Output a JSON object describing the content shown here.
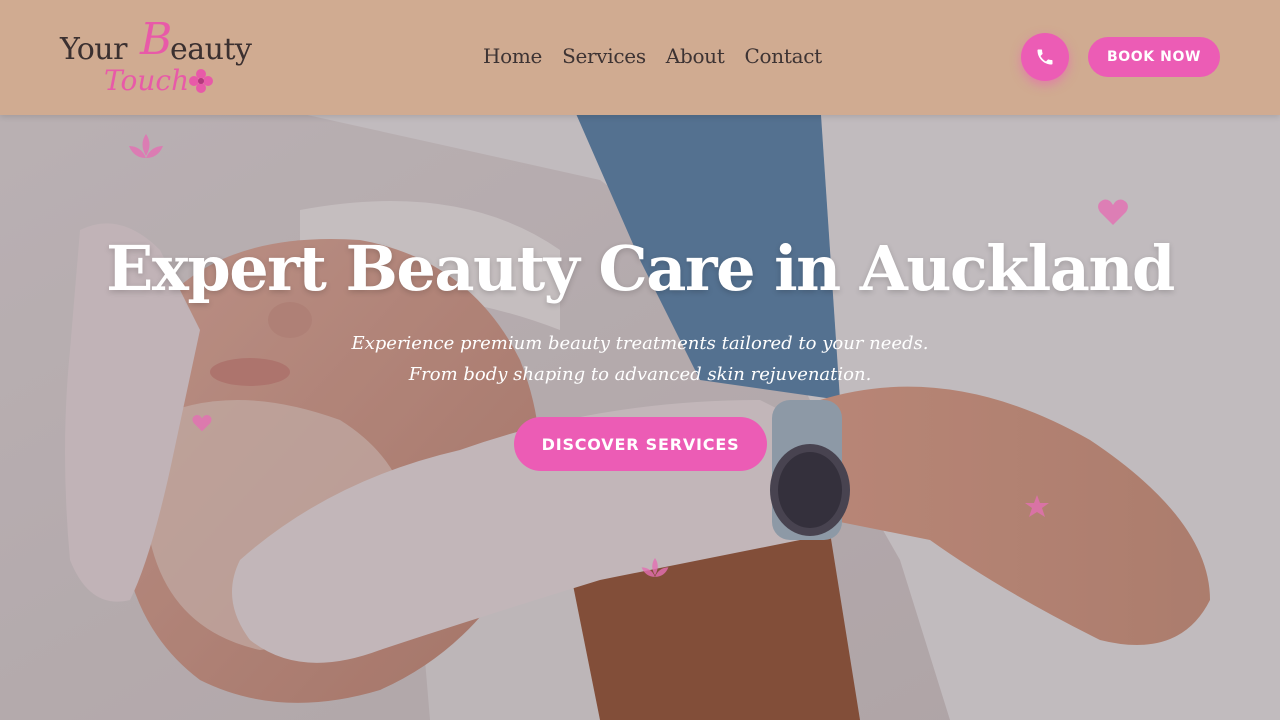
{
  "brand": {
    "logo_your": "Your",
    "logo_b": "B",
    "logo_eauty": "eauty",
    "logo_touch": "Touch",
    "accent_color": "#ec5cb5",
    "header_color": "#d0ab91"
  },
  "nav": {
    "items": [
      {
        "label": "Home"
      },
      {
        "label": "Services"
      },
      {
        "label": "About"
      },
      {
        "label": "Contact"
      }
    ]
  },
  "header_actions": {
    "phone_icon": "phone-icon",
    "book_label": "BOOK NOW"
  },
  "hero": {
    "title": "Expert Beauty Care in Auckland",
    "subtitle": "Experience premium beauty treatments tailored to your needs. From body shaping to advanced skin rejuvenation.",
    "cta_label": "DISCOVER SERVICES"
  },
  "decorations": [
    "lotus-icon",
    "heart-icon",
    "star-icon",
    "lotus-icon",
    "heart-icon"
  ]
}
